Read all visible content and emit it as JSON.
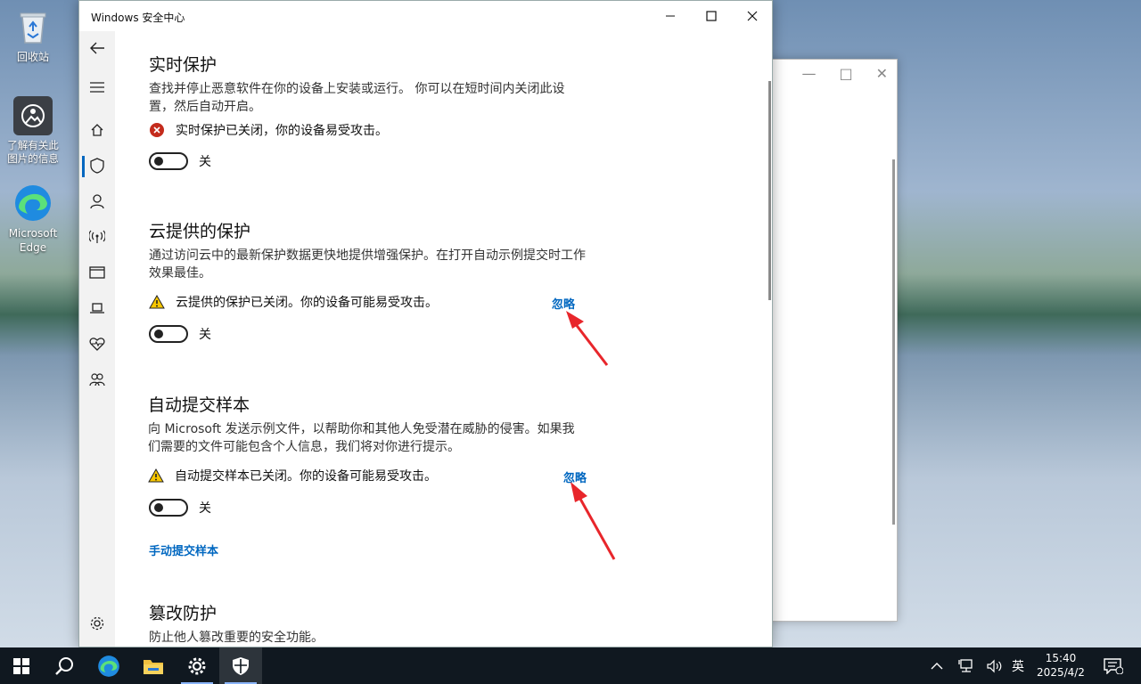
{
  "desktop": {
    "icons": [
      {
        "label": "回收站"
      },
      {
        "label": "了解有关此图片的信息"
      },
      {
        "label": "Microsoft Edge"
      }
    ]
  },
  "window": {
    "title": "Windows 安全中心"
  },
  "sections": {
    "realtime": {
      "title": "实时保护",
      "desc": "查找并停止恶意软件在你的设备上安装或运行。 你可以在短时间内关闭此设置，然后自动开启。",
      "status": "实时保护已关闭，你的设备易受攻击。",
      "toggle_label": "关"
    },
    "cloud": {
      "title": "云提供的保护",
      "desc": "通过访问云中的最新保护数据更快地提供增强保护。在打开自动示例提交时工作效果最佳。",
      "status": "云提供的保护已关闭。你的设备可能易受攻击。",
      "dismiss": "忽略",
      "toggle_label": "关"
    },
    "sample": {
      "title": "自动提交样本",
      "desc": "向 Microsoft 发送示例文件，以帮助你和其他人免受潜在威胁的侵害。如果我们需要的文件可能包含个人信息，我们将对你进行提示。",
      "status": "自动提交样本已关闭。你的设备可能易受攻击。",
      "dismiss": "忽略",
      "toggle_label": "关",
      "manual_link": "手动提交样本"
    },
    "tamper": {
      "title": "篡改防护",
      "desc": "防止他人篡改重要的安全功能。"
    }
  },
  "taskbar": {
    "ime": "英",
    "time": "15:40",
    "date": "2025/4/2"
  },
  "colors": {
    "accent": "#0067c0",
    "error": "#c42b1c",
    "warning": "#f7c600",
    "arrow": "#e8262b"
  }
}
